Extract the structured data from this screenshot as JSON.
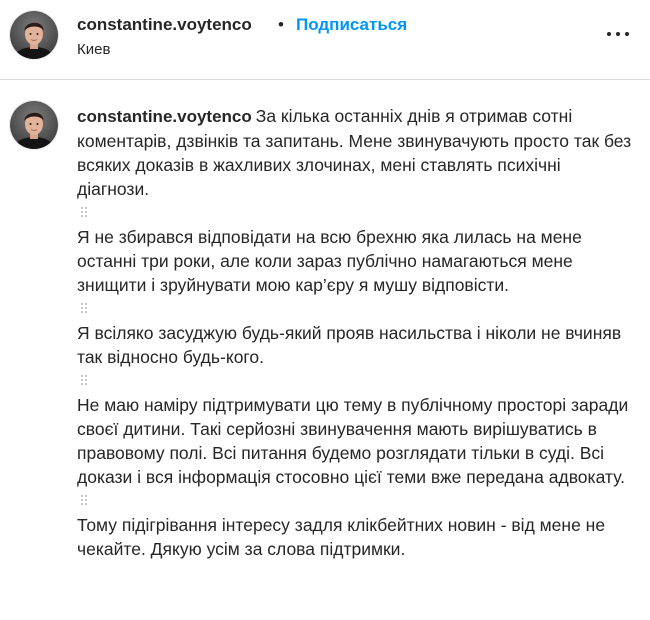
{
  "post": {
    "username": "constantine.voytenco",
    "separator": "•",
    "follow_label": "Подписаться",
    "location": "Киев",
    "more_icon": "more-horizontal-icon"
  },
  "caption": {
    "username": "constantine.voytenco",
    "paragraphs": [
      "За кілька останніх днів я отримав сотні коментарів, дзвінків та запитань. Мене звинувачують просто так без всяких доказів в жахливих злочинах, мені ставлять психічні діагнози.",
      "Я не збирався відповідати на всю брехню яка лилась на мене останні три роки, але коли зараз публічно намагаються мене знищити і зруйнувати мою кар’єру я мушу відповісти.",
      "Я всіляко засуджую будь-який прояв насильства і ніколи не вчиняв так відносно будь-кого.",
      "Не маю наміру підтримувати цю тему в публічному просторі заради своєї дитини. Такі серйозні звинувачення мають вирішуватись в правовому полі. Всі питання будемо розглядати тільки в суді. Всі докази і вся інформація стосовно цієї теми вже передана адвокату.",
      "Тому підігрівання інтересу задля клікбейтних новин - від мене не чекайте. Дякую усім за слова підтримки."
    ],
    "separator_icon": "braille-dots-icon"
  },
  "colors": {
    "text": "#262626",
    "link": "#0095f6",
    "divider": "#dbdbdb"
  }
}
